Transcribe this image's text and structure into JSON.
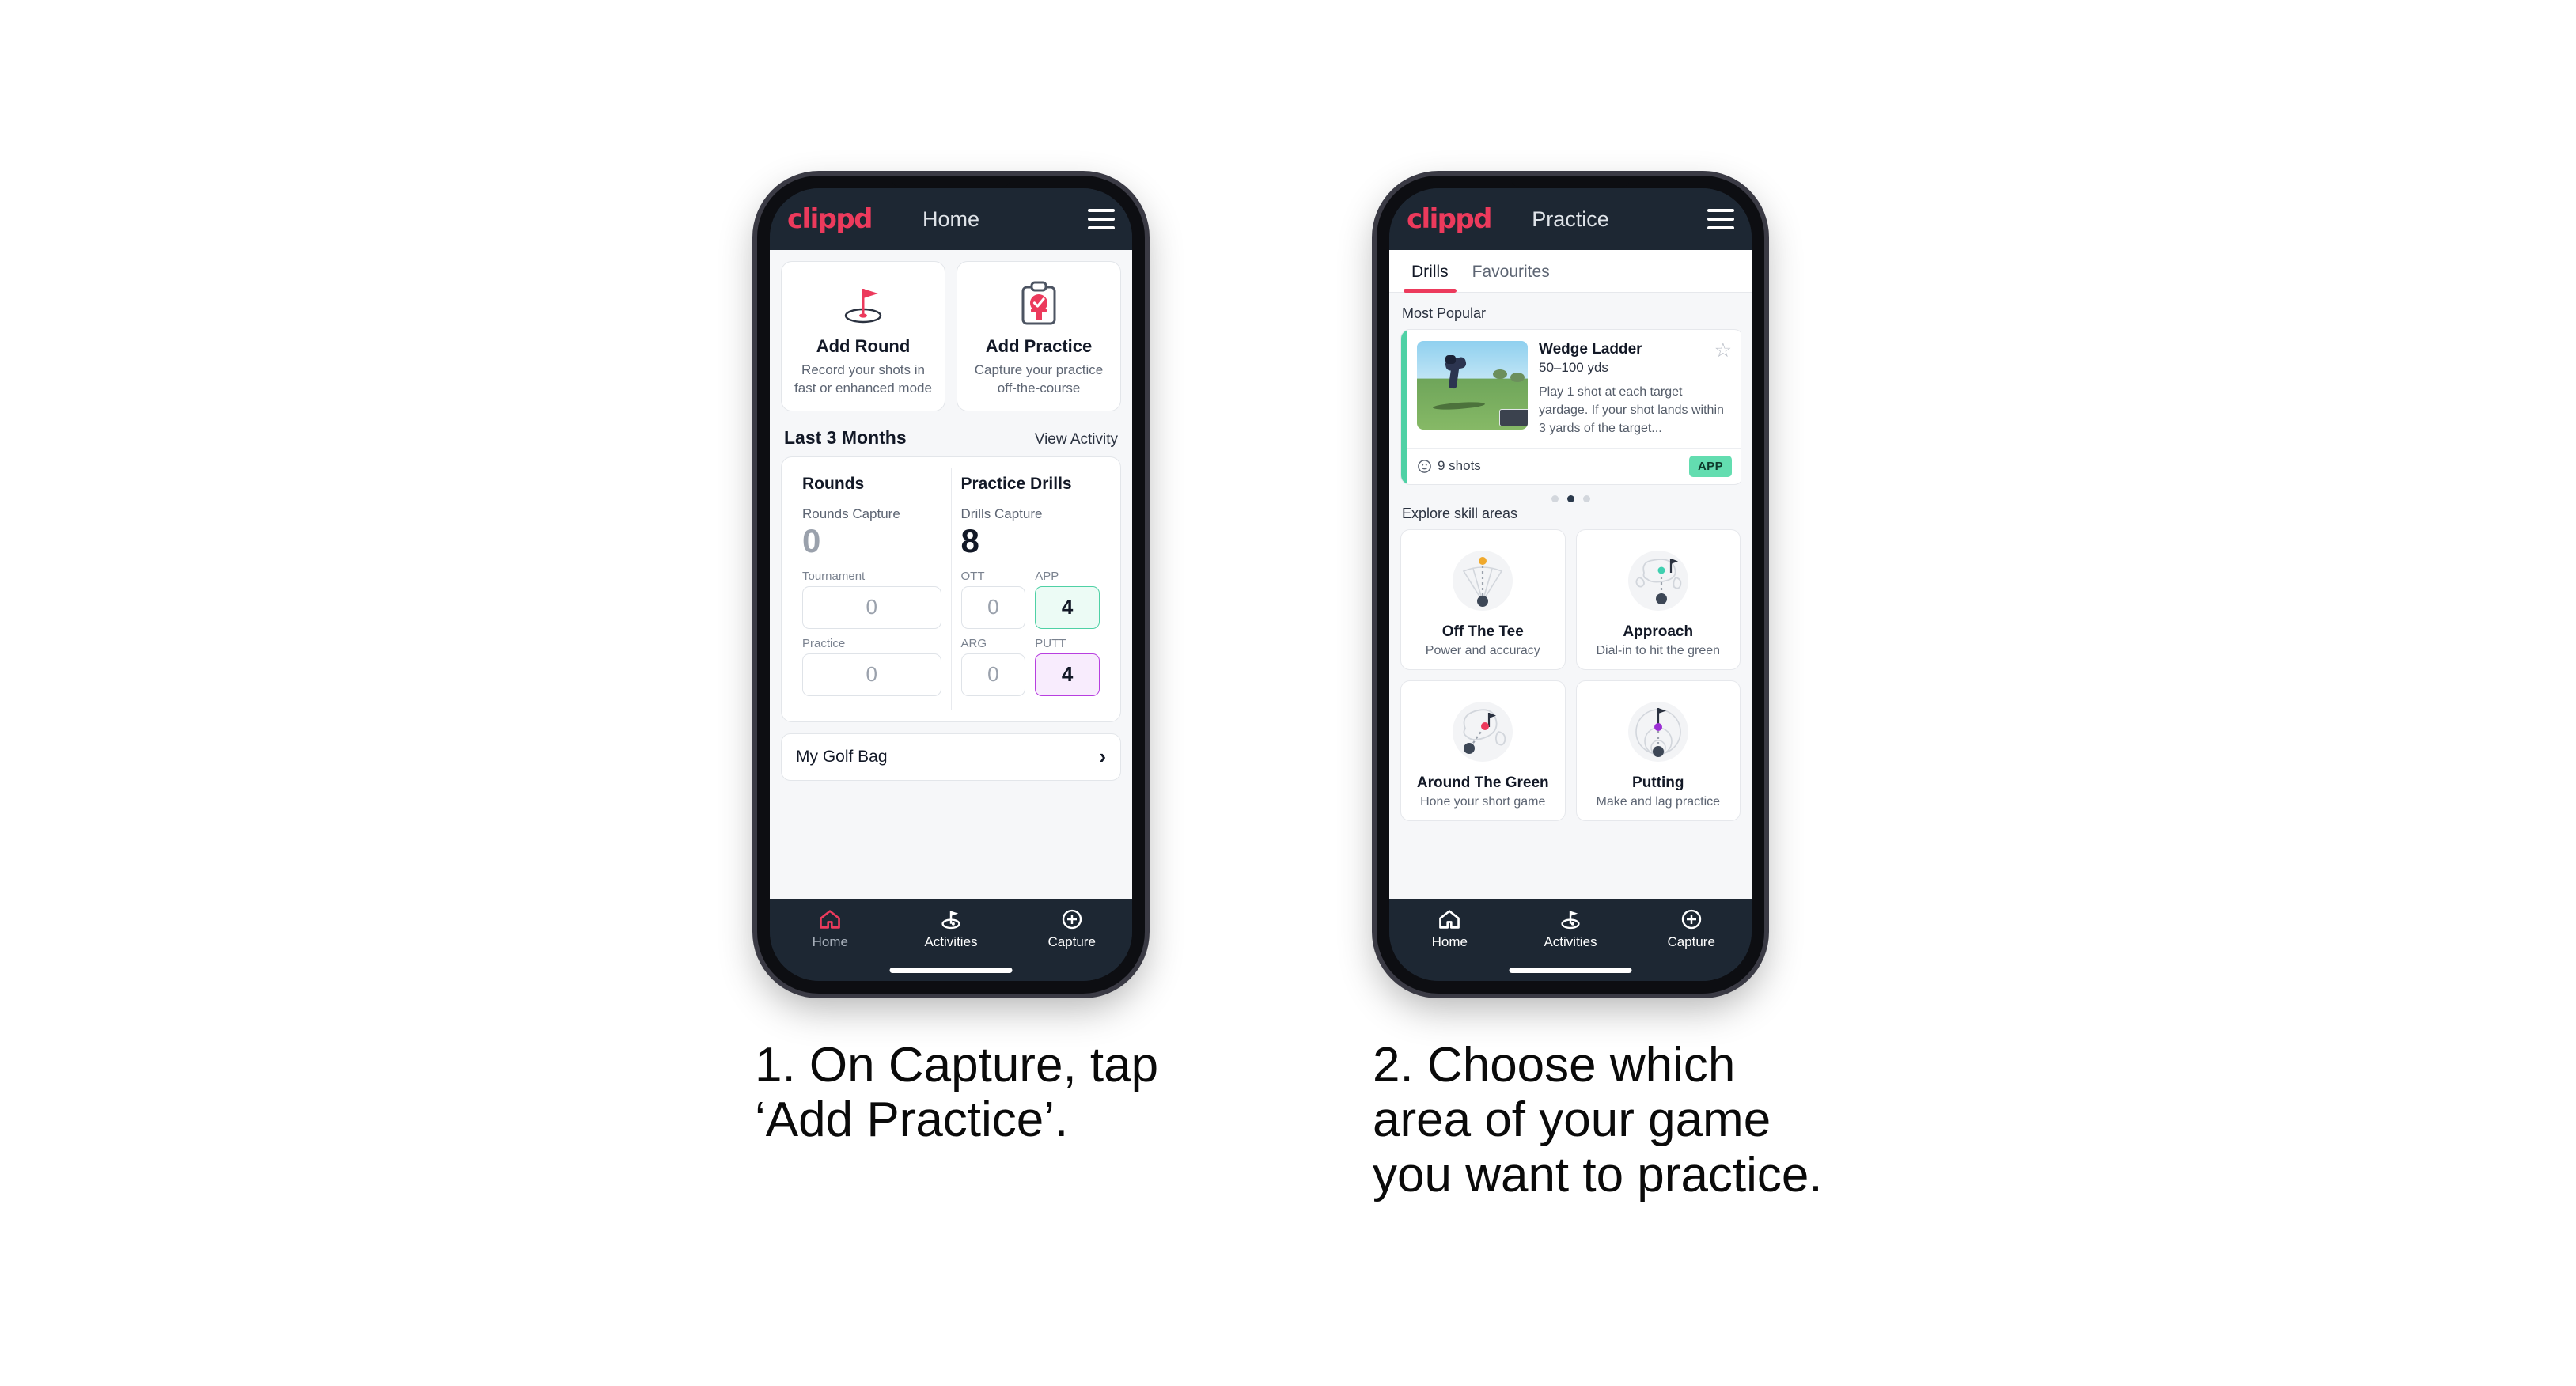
{
  "phone1": {
    "header": {
      "logo": "clippd",
      "title": "Home",
      "menu_icon": "hamburger-menu-icon"
    },
    "actions": [
      {
        "icon": "golf-flag-hole-icon",
        "title": "Add Round",
        "subtitle": "Record your shots in fast or enhanced mode"
      },
      {
        "icon": "clipboard-check-icon",
        "title": "Add Practice",
        "subtitle": "Capture your practice off-the-course"
      }
    ],
    "section": {
      "title": "Last 3 Months",
      "link": "View Activity"
    },
    "rounds": {
      "heading": "Rounds",
      "capture_label": "Rounds Capture",
      "capture_value": "0",
      "fields": [
        {
          "label": "Tournament",
          "value": "0",
          "state": "empty"
        },
        {
          "label": "Practice",
          "value": "0",
          "state": "empty"
        }
      ]
    },
    "drills": {
      "heading": "Practice Drills",
      "capture_label": "Drills Capture",
      "capture_value": "8",
      "fields": [
        {
          "label": "OTT",
          "value": "0",
          "state": "empty"
        },
        {
          "label": "APP",
          "value": "4",
          "state": "green"
        },
        {
          "label": "ARG",
          "value": "0",
          "state": "empty"
        },
        {
          "label": "PUTT",
          "value": "4",
          "state": "purple"
        }
      ]
    },
    "golf_bag": {
      "label": "My Golf Bag",
      "chevron": "chevron-right-icon"
    },
    "tabbar": [
      {
        "label": "Home",
        "icon": "home-icon",
        "active": true
      },
      {
        "label": "Activities",
        "icon": "golf-flag-icon",
        "active": false
      },
      {
        "label": "Capture",
        "icon": "plus-circle-icon",
        "active": false
      }
    ]
  },
  "phone2": {
    "header": {
      "logo": "clippd",
      "title": "Practice",
      "menu_icon": "hamburger-menu-icon"
    },
    "tabs": [
      {
        "label": "Drills",
        "active": true
      },
      {
        "label": "Favourites",
        "active": false
      }
    ],
    "most_popular_label": "Most Popular",
    "drill": {
      "name": "Wedge Ladder",
      "yardage": "50–100 yds",
      "description": "Play 1 shot at each target yardage. If your shot lands within 3 yards of the target...",
      "shots": "9 shots",
      "shots_icon": "clock-icon",
      "badge": "APP",
      "badge_color": "#63ddb0",
      "accent_color": "#4fd1a5",
      "next_accent_color": "#b83fe0",
      "favourite_icon": "star-outline-icon",
      "thumbnail": "golfer-chipping-photo"
    },
    "carousel_dots": {
      "count": 3,
      "active_index": 1
    },
    "explore_label": "Explore skill areas",
    "skills": [
      {
        "title": "Off The Tee",
        "subtitle": "Power and accuracy",
        "icon": "tee-shot-dispersion-icon",
        "accent": "#f0a92c"
      },
      {
        "title": "Approach",
        "subtitle": "Dial-in to hit the green",
        "icon": "green-approach-icon",
        "accent": "#3fd0b0"
      },
      {
        "title": "Around The Green",
        "subtitle": "Hone your short game",
        "icon": "chip-to-green-icon",
        "accent": "#ec3a5c"
      },
      {
        "title": "Putting",
        "subtitle": "Make and lag practice",
        "icon": "putting-rings-icon",
        "accent": "#9b2fd4"
      }
    ],
    "tabbar": [
      {
        "label": "Home",
        "icon": "home-icon",
        "active": false
      },
      {
        "label": "Activities",
        "icon": "golf-flag-icon",
        "active": true
      },
      {
        "label": "Capture",
        "icon": "plus-circle-icon",
        "active": false
      }
    ]
  },
  "captions": {
    "step1": "1. On Capture, tap\n‘Add Practice’.",
    "step2": "2. Choose which\narea of your game\nyou want to practice."
  },
  "colors": {
    "brand_pink": "#ec3a5c",
    "header_dark": "#1d2733",
    "app_bg": "#f6f7f9",
    "green": "#4fd1a5",
    "purple": "#b83fe0"
  }
}
